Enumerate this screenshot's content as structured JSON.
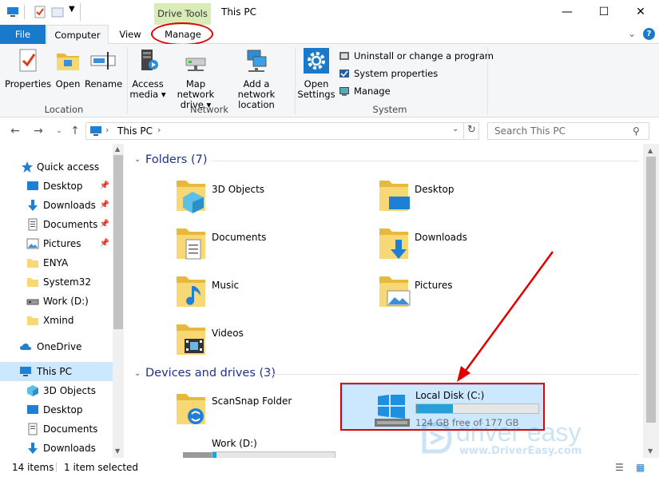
{
  "window": {
    "title": "This PC",
    "context_tab": "Drive Tools",
    "buttons": {
      "minimize": "—",
      "maximize": "☐",
      "close": "✕"
    }
  },
  "tabs": [
    {
      "label": "File"
    },
    {
      "label": "Computer"
    },
    {
      "label": "View"
    },
    {
      "label": "Manage"
    }
  ],
  "ribbon": {
    "location": {
      "label": "Location",
      "buttons": [
        "Properties",
        "Open",
        "Rename"
      ]
    },
    "network": {
      "label": "Network",
      "access_media": [
        "Access",
        "media ▾"
      ],
      "map_drive": [
        "Map network",
        "drive ▾"
      ],
      "add_location": [
        "Add a network",
        "location"
      ]
    },
    "system": {
      "label": "System",
      "open_settings": [
        "Open",
        "Settings"
      ],
      "uninstall": "Uninstall or change a program",
      "properties": "System properties",
      "manage": "Manage"
    }
  },
  "address": {
    "path": "This PC",
    "search_placeholder": "Search This PC"
  },
  "nav": {
    "quick_access": "Quick access",
    "items": [
      {
        "label": "Desktop",
        "pinned": true
      },
      {
        "label": "Downloads",
        "pinned": true
      },
      {
        "label": "Documents",
        "pinned": true
      },
      {
        "label": "Pictures",
        "pinned": true
      },
      {
        "label": "ENYA"
      },
      {
        "label": "System32"
      },
      {
        "label": "Work (D:)"
      },
      {
        "label": "Xmind"
      }
    ],
    "onedrive": "OneDrive",
    "thispc": "This PC",
    "thispc_children": [
      "3D Objects",
      "Desktop",
      "Documents",
      "Downloads"
    ]
  },
  "folders": {
    "header": "Folders (7)",
    "items": [
      "3D Objects",
      "Desktop",
      "Documents",
      "Downloads",
      "Music",
      "Pictures",
      "Videos"
    ]
  },
  "devices": {
    "header": "Devices and drives (3)",
    "scansnap": "ScanSnap Folder",
    "local_disk": {
      "name": "Local Disk (C:)",
      "free_text": "124 GB free of 177 GB",
      "used_fraction": 0.3
    },
    "work_drive": {
      "name": "Work (D:)",
      "used_fraction": 0.03
    }
  },
  "status": {
    "items": "14 items",
    "selected": "1 item selected"
  },
  "watermark": {
    "brand": "driver easy",
    "url": "www.DriverEasy.com"
  },
  "colors": {
    "accent": "#1979ca",
    "highlight_red": "#e00000",
    "selected_bg": "#cce8ff",
    "drive_fill": "#26a0da",
    "context_tab": "#d9ebb6"
  }
}
